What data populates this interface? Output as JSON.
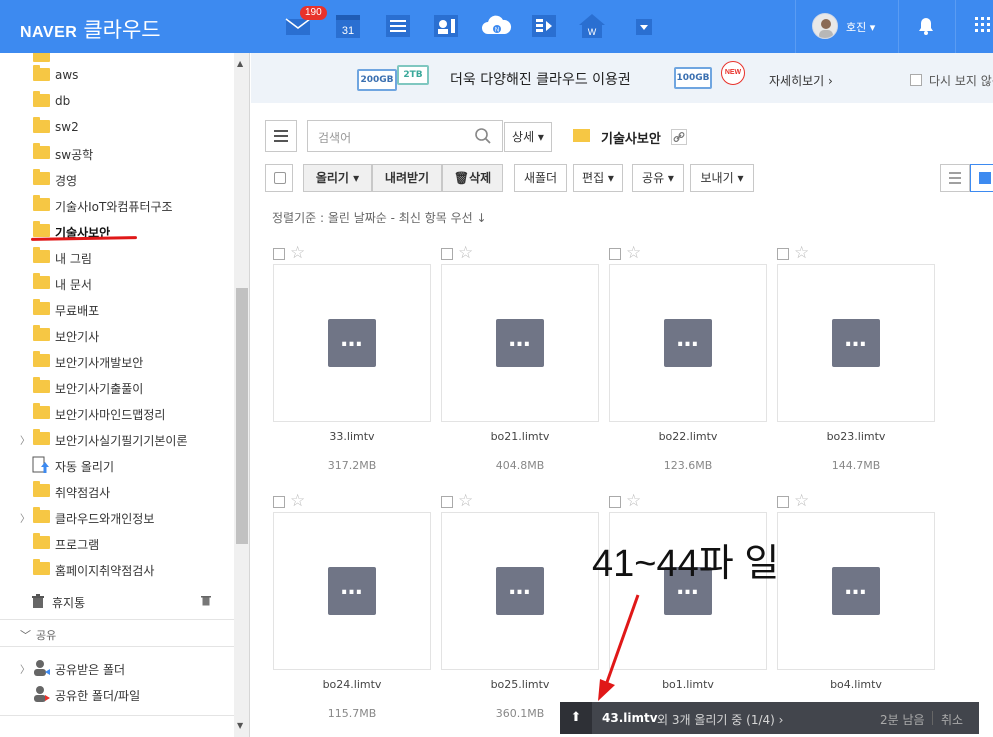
{
  "header": {
    "brand": "NAVER",
    "product": "클라우드",
    "mail_badge": "190",
    "calendar_day": "31",
    "user_name": "호진 ▾"
  },
  "sidebar": {
    "items": [
      {
        "label": "aws"
      },
      {
        "label": "db"
      },
      {
        "label": "sw2"
      },
      {
        "label": "sw공학"
      },
      {
        "label": "경영"
      },
      {
        "label": "기술사IoT와컴퓨터구조"
      },
      {
        "label": "기술사보안"
      },
      {
        "label": "내 그림"
      },
      {
        "label": "내 문서"
      },
      {
        "label": "무료배포"
      },
      {
        "label": "보안기사"
      },
      {
        "label": "보안기사개발보안"
      },
      {
        "label": "보안기사기출풀이"
      },
      {
        "label": "보안기사마인드맵정리"
      },
      {
        "label": "보안기사실기필기기본이론"
      },
      {
        "label": "자동 올리기"
      },
      {
        "label": "취약점검사"
      },
      {
        "label": "클라우드와개인정보"
      },
      {
        "label": "프로그램"
      },
      {
        "label": "홈페이지취약점검사"
      }
    ],
    "trash_label": "휴지통",
    "share_header": "공유",
    "shared_received": "공유받은 폴더",
    "shared_by_me": "공유한 폴더/파일"
  },
  "banner": {
    "badge_200": "200GB",
    "badge_2tb": "2TB",
    "text": "더욱 다양해진 클라우드 이용권",
    "badge_100": "100GB",
    "new": "NEW",
    "more": "자세히보기 ›",
    "dont_show": "다시 보지 않음"
  },
  "toolbar": {
    "search_placeholder": "검색어",
    "detail": "상세 ▾",
    "current_folder": "기술사보안",
    "upload": "올리기 ▾",
    "download": "내려받기",
    "delete": "삭제",
    "new_folder": "새폴더",
    "edit": "편집 ▾",
    "share": "공유 ▾",
    "export": "보내기 ▾"
  },
  "sort_text": "정렬기준 : 올린 날짜순 - 최신 항목 우선 ↓",
  "files": [
    {
      "name": "33.limtv",
      "size": "317.2MB"
    },
    {
      "name": "bo21.limtv",
      "size": "404.8MB"
    },
    {
      "name": "bo22.limtv",
      "size": "123.6MB"
    },
    {
      "name": "bo23.limtv",
      "size": "144.7MB"
    },
    {
      "name": "bo24.limtv",
      "size": "115.7MB"
    },
    {
      "name": "bo25.limtv",
      "size": "360.1MB"
    },
    {
      "name": "bo1.limtv",
      "size": ""
    },
    {
      "name": "bo4.limtv",
      "size": ""
    }
  ],
  "annotation": "41~44파 일",
  "upload_bar": {
    "file": "43.limtv",
    "status": "외 3개 올리기 중 (1/4) ›",
    "remaining": "2분 남음",
    "cancel": "취소"
  }
}
